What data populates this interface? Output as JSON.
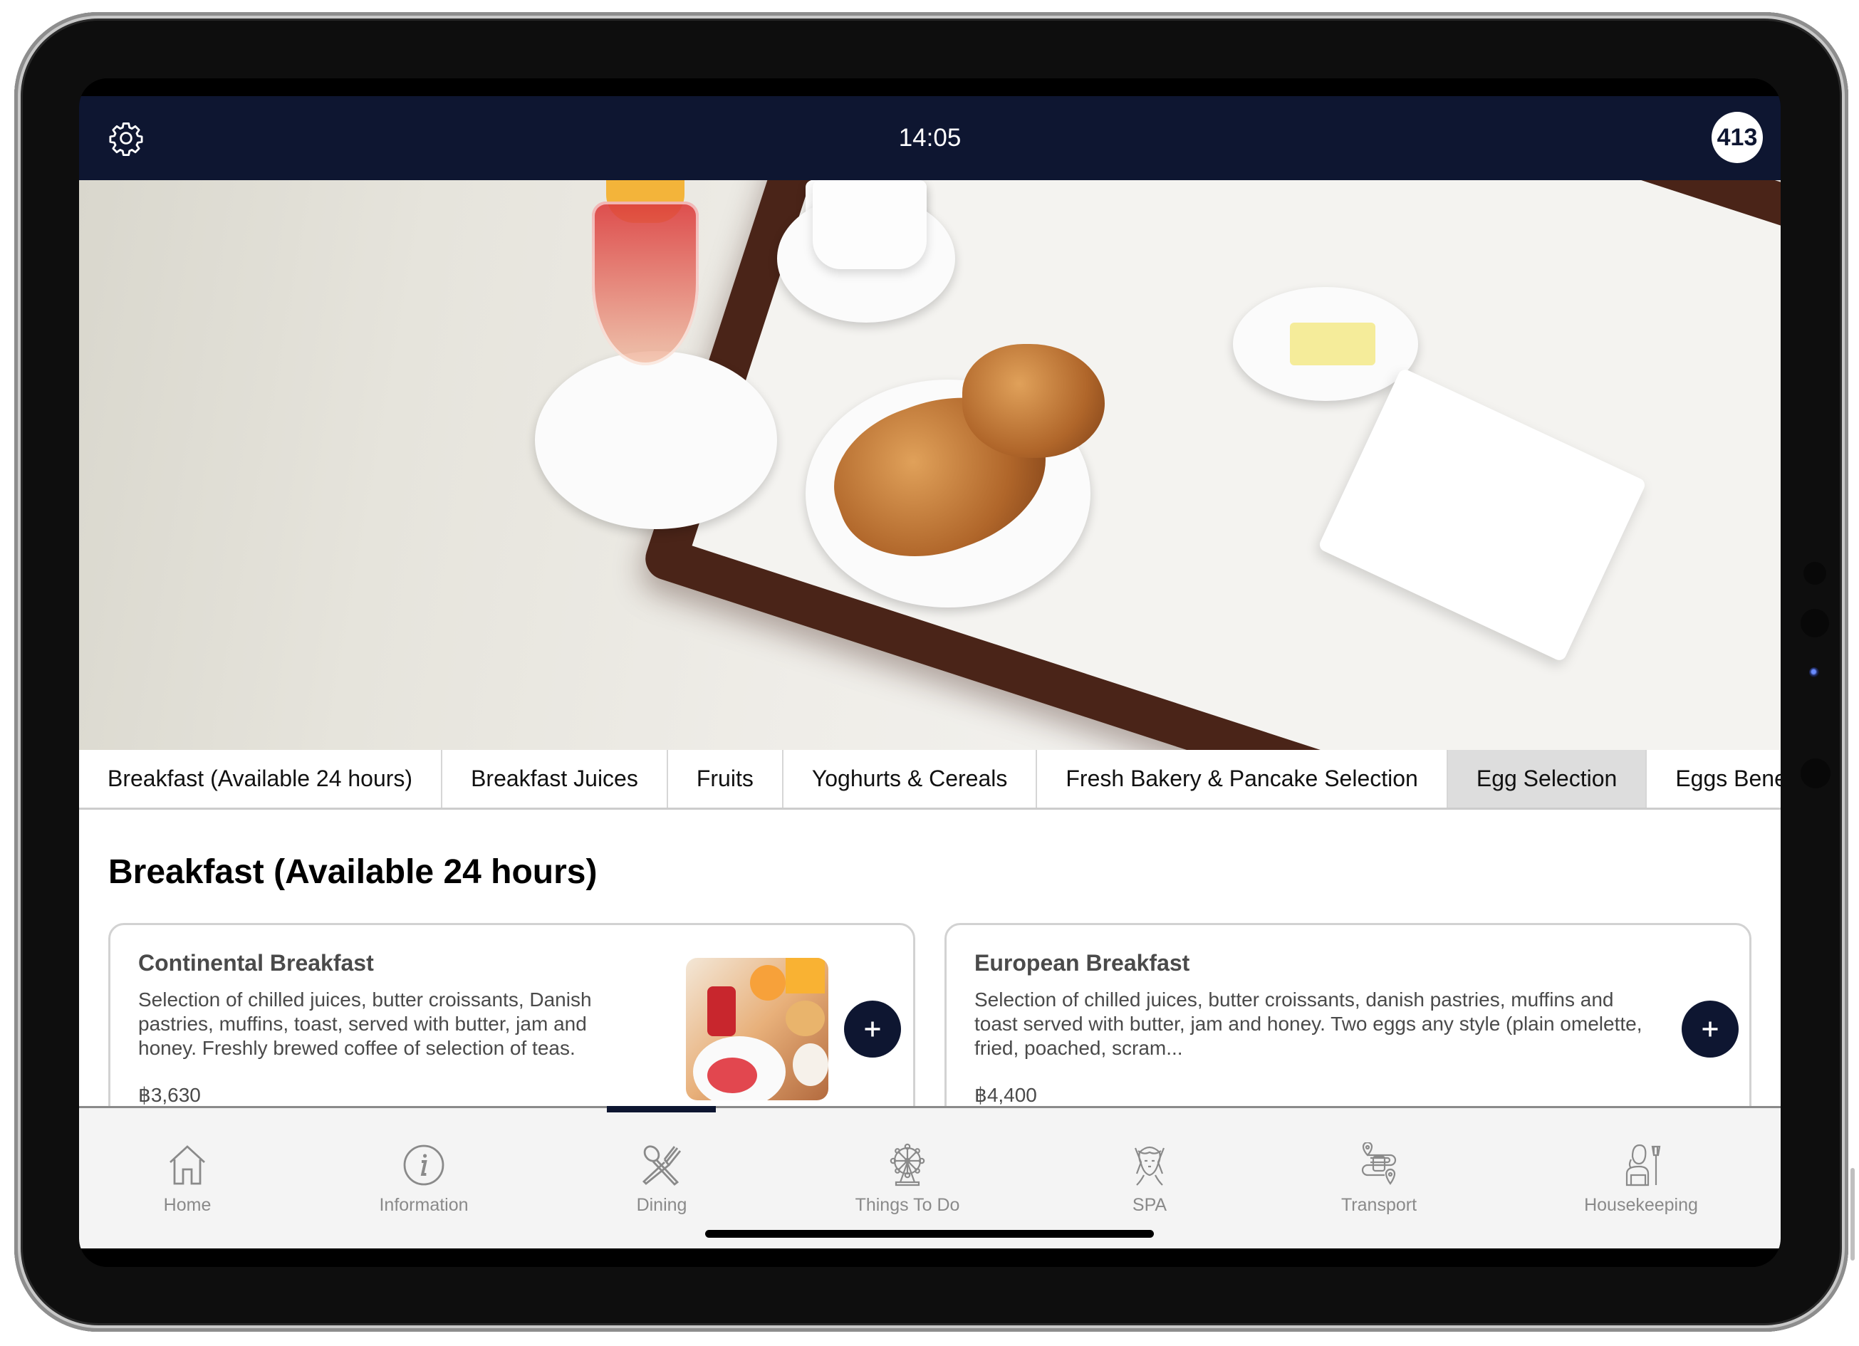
{
  "topbar": {
    "settings_icon": "gear-icon",
    "time": "14:05",
    "room_number": "413"
  },
  "hero": {
    "image": "breakfast-tray-photo"
  },
  "category_tabs": [
    {
      "label": "Breakfast (Available 24 hours)",
      "active": false
    },
    {
      "label": "Breakfast Juices",
      "active": false
    },
    {
      "label": "Fruits",
      "active": false
    },
    {
      "label": "Yoghurts & Cereals",
      "active": false
    },
    {
      "label": "Fresh Bakery & Pancake Selection",
      "active": false
    },
    {
      "label": "Egg Selection",
      "active": true
    },
    {
      "label": "Eggs Bene",
      "active": false
    }
  ],
  "section": {
    "title": "Breakfast (Available 24 hours)",
    "items": [
      {
        "name": "Continental Breakfast",
        "description": "Selection of chilled juices, butter croissants, Danish pastries, muffins, toast, served with butter, jam and honey. Freshly brewed coffee of selection of teas.",
        "price": "฿3,630",
        "has_image": true,
        "add_icon": "plus-icon"
      },
      {
        "name": "European Breakfast",
        "description": "Selection of chilled juices, butter croissants, danish pastries, muffins and toast served with butter, jam and honey. Two eggs any style (plain omelette, fried, poached, scram...",
        "price": "฿4,400",
        "has_image": false,
        "add_icon": "plus-icon"
      }
    ]
  },
  "bottom_nav": {
    "active": "Dining",
    "items": [
      {
        "label": "Home",
        "icon": "home-icon"
      },
      {
        "label": "Information",
        "icon": "info-icon"
      },
      {
        "label": "Dining",
        "icon": "fork-spoon-icon"
      },
      {
        "label": "Things To Do",
        "icon": "ferris-wheel-icon"
      },
      {
        "label": "SPA",
        "icon": "spa-face-icon"
      },
      {
        "label": "Transport",
        "icon": "transport-route-icon"
      },
      {
        "label": "Housekeeping",
        "icon": "housekeeper-icon"
      }
    ]
  },
  "colors": {
    "brand_navy": "#0e1631",
    "active_tab_bg": "#dddddd",
    "nav_bg": "#f4f4f4",
    "nav_icon_gray": "#8a8a8a"
  }
}
